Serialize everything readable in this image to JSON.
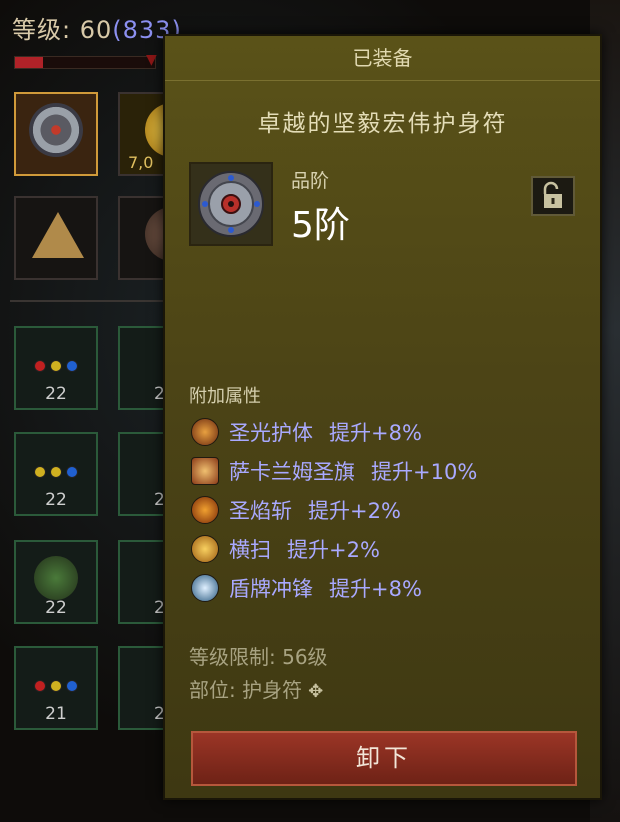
{
  "character": {
    "level_label": "等级:",
    "level_value": "60",
    "paragon": "(833)",
    "xp_fraction": 0.2
  },
  "inventory": {
    "partial_value": "7,0",
    "item_levels": [
      "22",
      "22",
      "22",
      "21"
    ],
    "partial_levels": [
      "2",
      "2",
      "2",
      "2"
    ]
  },
  "tooltip": {
    "status": "已装备",
    "item_name": "卓越的坚毅宏伟护身符",
    "rank_label": "品阶",
    "rank_value": "5阶",
    "attributes_header": "附加属性",
    "attributes": [
      {
        "icon": "holy-armor-icon",
        "name": "圣光护体",
        "bonus": "提升+8%"
      },
      {
        "icon": "banner-icon",
        "name": "萨卡兰姆圣旗",
        "bonus": "提升+10%"
      },
      {
        "icon": "flame-slash-icon",
        "name": "圣焰斩",
        "bonus": "提升+2%"
      },
      {
        "icon": "sweep-icon",
        "name": "横扫",
        "bonus": "提升+2%"
      },
      {
        "icon": "shield-charge-icon",
        "name": "盾牌冲锋",
        "bonus": "提升+8%"
      }
    ],
    "level_requirement": "等级限制: 56级",
    "slot": "部位: 护身符",
    "unequip_label": "卸下"
  },
  "colors": {
    "panel": "#4c4416",
    "attribute_text": "#a9a9ff",
    "button": "#8b2d20"
  }
}
